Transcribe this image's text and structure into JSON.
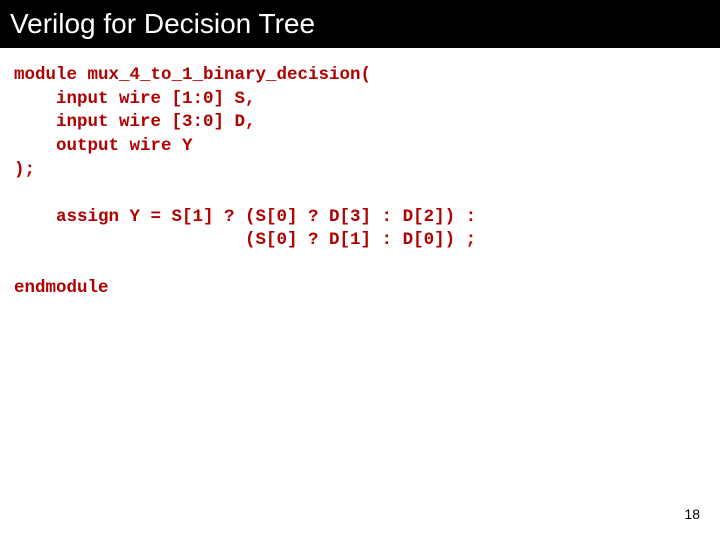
{
  "slide": {
    "title": "Verilog for Decision Tree",
    "page_number": "18"
  },
  "code": {
    "l1": "module mux_4_to_1_binary_decision(",
    "l2": "    input wire [1:0] S,",
    "l3": "    input wire [3:0] D,",
    "l4": "    output wire Y",
    "l5": ");",
    "l6": "",
    "l7": "    assign Y = S[1] ? (S[0] ? D[3] : D[2]) :",
    "l8": "                      (S[0] ? D[1] : D[0]) ;",
    "l9": "",
    "l10": "endmodule"
  }
}
